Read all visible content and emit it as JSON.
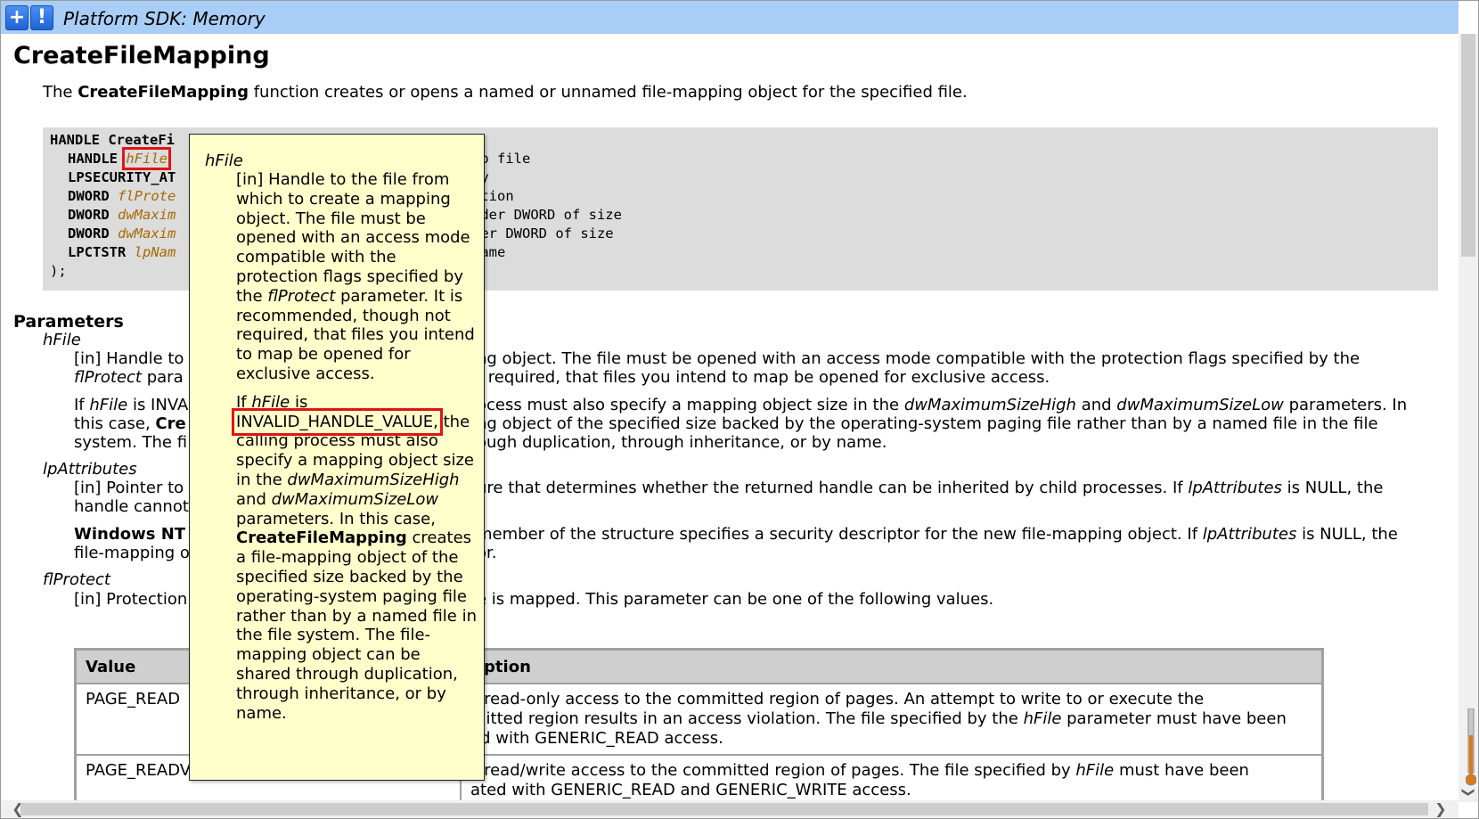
{
  "window": {
    "title": "Platform SDK: Memory",
    "plus_label": "+",
    "alert_label": "!"
  },
  "page": {
    "title": "CreateFileMapping",
    "intro_pre": "The ",
    "intro_bold": "CreateFileMapping",
    "intro_post": " function creates or opens a named or unnamed file-mapping object for the specified file."
  },
  "syntax": {
    "line0": "HANDLE CreateFi",
    "lines": [
      {
        "type": "HANDLE",
        "param": "hFile",
        "comment": "to file"
      },
      {
        "type": "LPSECURITY_AT",
        "param": "",
        "comment": "ty"
      },
      {
        "type": "DWORD",
        "param": "flProte",
        "comment": "ction"
      },
      {
        "type": "DWORD",
        "param": "dwMaxim",
        "comment": "rder DWORD of size"
      },
      {
        "type": "DWORD",
        "param": "dwMaxim",
        "comment": "der DWORD of size"
      },
      {
        "type": "LPCTSTR",
        "param": "lpNam",
        "comment": "name"
      }
    ],
    "close": ");"
  },
  "parameters": {
    "heading": "Parameters",
    "hfile": {
      "name": "hFile",
      "l1a": "[in] Handle to",
      "l1b": "ng object. The file must be opened with an access mode compatible with the protection flags specified by the",
      "l2a": "flProtect",
      "l2b": " para",
      "l2c": "t required, that files you intend to map be opened for exclusive access.",
      "l3a": "If ",
      "l3b": "hFile",
      "l3c": " is INVA",
      "l3d": "ocess must also specify a mapping object size in the ",
      "l3e": "dwMaximumSizeHigh",
      "l3f": " and ",
      "l3g": "dwMaximumSizeLow",
      "l3h": " parameters. In",
      "l4a": "this case, ",
      "l4b": "Cre",
      "l4c": "ng object of the specified size backed by the operating-system paging file rather than by a named file in the file",
      "l5a": "system. The fi",
      "l5b": "ough duplication, through inheritance, or by name."
    },
    "lpattr": {
      "name": "lpAttributes",
      "l1a": "[in] Pointer to",
      "l1b": "ure that determines whether the returned handle can be inherited by child processes. If ",
      "l1c": "lpAttributes",
      "l1d": " is NULL, the",
      "l2a": "handle cannot",
      "l3a": "Windows NT",
      "l3b": "member of the structure specifies a security descriptor for the new file-mapping object. If ",
      "l3c": "lpAttributes",
      "l3d": " is NULL, the",
      "l4a": "file-mapping o",
      "l4b": "or."
    },
    "flprotect": {
      "name": "flProtect",
      "l1a": "[in] Protection",
      "l1b": "e is mapped. This parameter can be one of the following values."
    }
  },
  "table": {
    "headers": [
      "Value",
      "ription"
    ],
    "rows": [
      {
        "value": "PAGE_READ",
        "d1": "s read-only access to the committed region of pages. An attempt to write to or execute the",
        "d2a": "mitted region results in an access violation. The file specified by the ",
        "d2b": "hFile",
        "d2c": " parameter must have been",
        "d3": "ed with GENERIC_READ access."
      },
      {
        "value": "PAGE_READV",
        "d1a": "s read/write access to the committed region of pages. The file specified by ",
        "d1b": "hFile",
        "d1c": " must have been",
        "d2": "ated with GENERIC_READ and GENERIC_WRITE access."
      }
    ]
  },
  "tooltip": {
    "name": "hFile",
    "p1a": "[in] Handle to the file from which to create a mapping object. The file must be opened with an access mode compatible with the protection flags specified by the ",
    "p1b": "flProtect",
    "p1c": " parameter. It is recommended, though not required, that files you intend to map be opened for exclusive access.",
    "p2a": "If ",
    "p2b": "hFile",
    "p2c": " is",
    "p2code": "INVALID_HANDLE_VALUE,",
    "p2d": " the calling process must also specify a mapping object size in the ",
    "p2e": "dwMaximumSizeHigh",
    "p2f": " and ",
    "p2g": "dwMaximumSizeLow",
    "p2h": " parameters. In this case, ",
    "p2i": "CreateFileMapping",
    "p2j": " creates a file-mapping object of the specified size backed by the operating-system paging file rather than by a named file in the file system. The file-mapping object can be shared through duplication, through inheritance, or by name."
  },
  "scroll": {
    "left_arrow": "❮",
    "right_arrow": "❯",
    "down_arrow": "❯"
  }
}
